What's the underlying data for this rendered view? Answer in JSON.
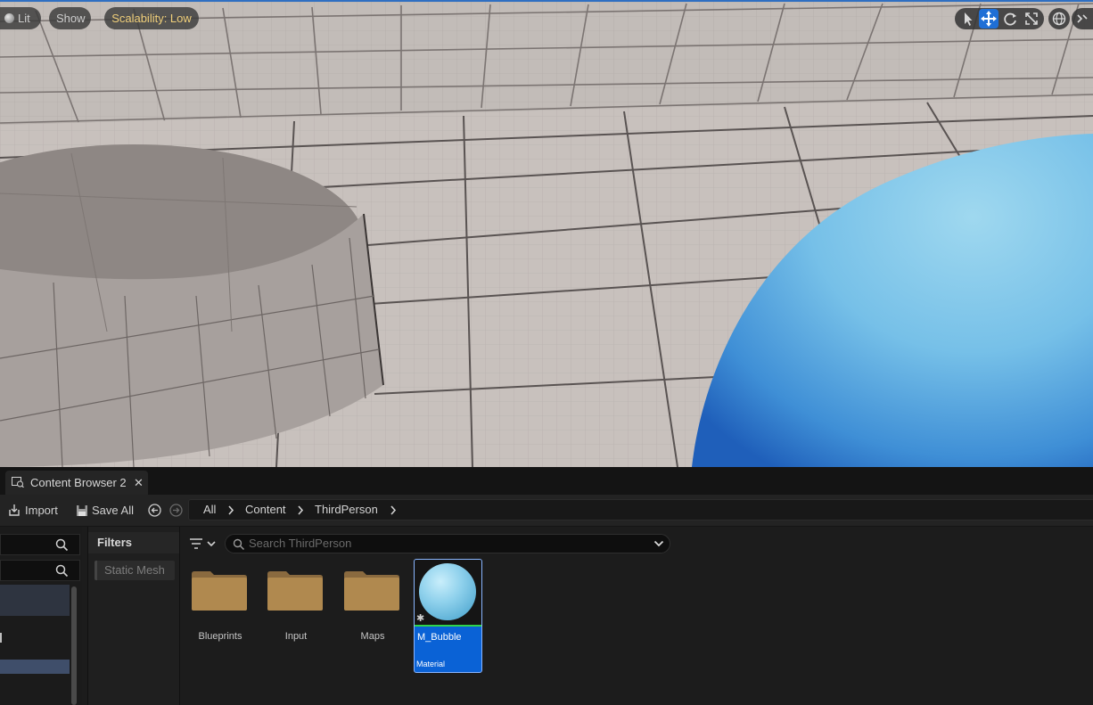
{
  "viewport": {
    "view_mode_label": "Lit",
    "show_label": "Show",
    "scalability_label": "Scalability: Low",
    "tools": [
      "select-icon",
      "translate-icon",
      "rotate-icon",
      "scale-icon"
    ],
    "active_tool": "translate-icon",
    "extra_icons": [
      "world-local-icon",
      "snap-icon"
    ],
    "accent": "#1f6fd6"
  },
  "content_browser": {
    "tab_label": "Content Browser 2",
    "tab_close": "✕",
    "toolbar": {
      "import_label": "Import",
      "save_all_label": "Save All"
    },
    "breadcrumbs": [
      "All",
      "Content",
      "ThirdPerson"
    ],
    "filters_header": "Filters",
    "filter_chip": "Static Mesh",
    "search_placeholder": "Search ThirdPerson",
    "folders": [
      "Blueprints",
      "Input",
      "Maps"
    ],
    "selected_asset": {
      "name": "M_Bubble",
      "type": "Material",
      "selection_color": "#0a62d6"
    }
  }
}
